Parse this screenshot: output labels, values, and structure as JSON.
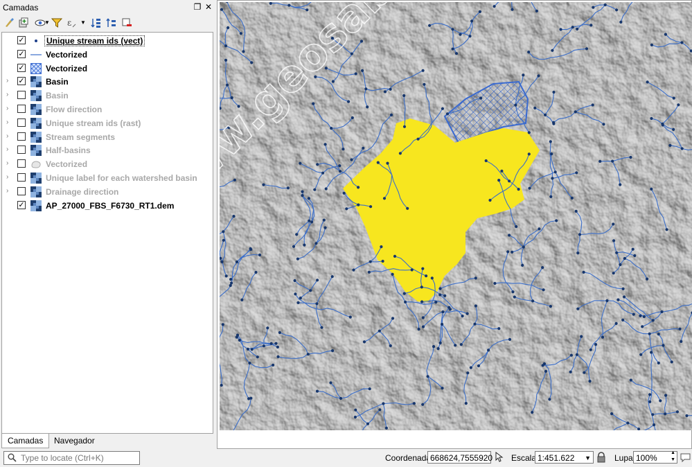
{
  "panel": {
    "title": "Camadas",
    "float_glyph": "❐",
    "close_glyph": "✕"
  },
  "toolbar_icons": [
    "style-manager-icon",
    "add-group-icon",
    "visibility-eye-icon",
    "filter-legend-icon",
    "filter-expression-icon",
    "expand-all-icon",
    "collapse-all-icon",
    "remove-layer-icon"
  ],
  "layers": [
    {
      "name": "Unique stream ids (vect)",
      "checked": true,
      "expandable": false,
      "symbol": "point",
      "selected": true
    },
    {
      "name": "Vectorized",
      "checked": true,
      "expandable": false,
      "symbol": "line"
    },
    {
      "name": "Vectorized",
      "checked": true,
      "expandable": false,
      "symbol": "hatch"
    },
    {
      "name": "Basin",
      "checked": true,
      "expandable": true,
      "symbol": "raster"
    },
    {
      "name": "Basin",
      "checked": false,
      "expandable": true,
      "symbol": "raster"
    },
    {
      "name": "Flow direction",
      "checked": false,
      "expandable": true,
      "symbol": "raster"
    },
    {
      "name": "Unique stream ids (rast)",
      "checked": false,
      "expandable": true,
      "symbol": "raster"
    },
    {
      "name": "Stream segments",
      "checked": false,
      "expandable": true,
      "symbol": "raster"
    },
    {
      "name": "Half-basins",
      "checked": false,
      "expandable": true,
      "symbol": "raster"
    },
    {
      "name": "Vectorized",
      "checked": false,
      "expandable": true,
      "symbol": "polygon"
    },
    {
      "name": "Unique label for each watershed basin",
      "checked": false,
      "expandable": true,
      "symbol": "raster"
    },
    {
      "name": "Drainage direction",
      "checked": false,
      "expandable": true,
      "symbol": "raster"
    },
    {
      "name": "AP_27000_FBS_F6730_RT1.dem",
      "checked": true,
      "expandable": false,
      "symbol": "raster"
    }
  ],
  "tabs": [
    "Camadas",
    "Navegador"
  ],
  "watermark": "http://www.geosaber.com.br",
  "colors": {
    "basin_fill": "#f7e61f",
    "stream": "#3b6ec9",
    "node": "#17366b",
    "hatch": "#3a6ad0",
    "hillshade": "#b5b5b5"
  },
  "status": {
    "locator_placeholder": "Type to locate (Ctrl+K)",
    "coord_label": "Coordenada",
    "coord_value": "668624,7555920",
    "scale_label": "Escala",
    "scale_value": "1:451.622",
    "magnifier_label": "Lupa",
    "magnifier_value": "100%"
  }
}
